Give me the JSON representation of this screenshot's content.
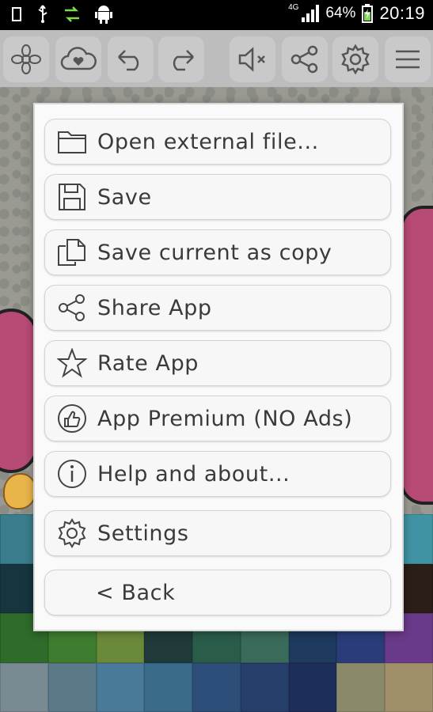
{
  "status_bar": {
    "network": "4G",
    "battery_percent": "64%",
    "time": "20:19"
  },
  "toolbar": {
    "buttons": [
      "mandala-icon",
      "cloud-heart-icon",
      "undo-icon",
      "redo-icon",
      "mute-icon",
      "share-icon",
      "settings-gear-icon",
      "menu-icon"
    ]
  },
  "menu": {
    "items": [
      {
        "label": "Open external file...",
        "icon": "folder-icon"
      },
      {
        "label": "Save",
        "icon": "floppy-disk-icon"
      },
      {
        "label": "Save current as copy",
        "icon": "copy-document-icon"
      },
      {
        "label": "Share App",
        "icon": "share-icon"
      },
      {
        "label": "Rate App",
        "icon": "star-icon"
      },
      {
        "label": "App Premium (NO Ads)",
        "icon": "thumbs-up-icon"
      },
      {
        "label": "Help and about...",
        "icon": "info-icon"
      },
      {
        "label": "Settings",
        "icon": "gear-icon"
      },
      {
        "label": "< Back",
        "icon": ""
      }
    ]
  },
  "palette": {
    "colors": [
      "#3a7d8c",
      "#2f8aa0",
      "#4a9aa8",
      "#3d8f9a",
      "#55a3b2",
      "#4a8fa6",
      "#3a8fa8",
      "#2c7d96",
      "#3f93a3",
      "#16353f",
      "#1e4555",
      "#234b5a",
      "#1c3c4a",
      "#25566a",
      "#2a4e5e",
      "#1e3a48",
      "#3b2a22",
      "#2a1e16",
      "#2f6b2a",
      "#3e7d2f",
      "#6a8a3a",
      "#1f3a38",
      "#2a5c4a",
      "#3a6a5a",
      "#1e3a5e",
      "#2a3d7a",
      "#6a3a8a",
      "#7a8a92",
      "#5a7a8a",
      "#4a7a9a",
      "#3a6a8a",
      "#2e4e7a",
      "#253e6a",
      "#1e2e5a",
      "#8a8a6a",
      "#a0906a"
    ]
  }
}
